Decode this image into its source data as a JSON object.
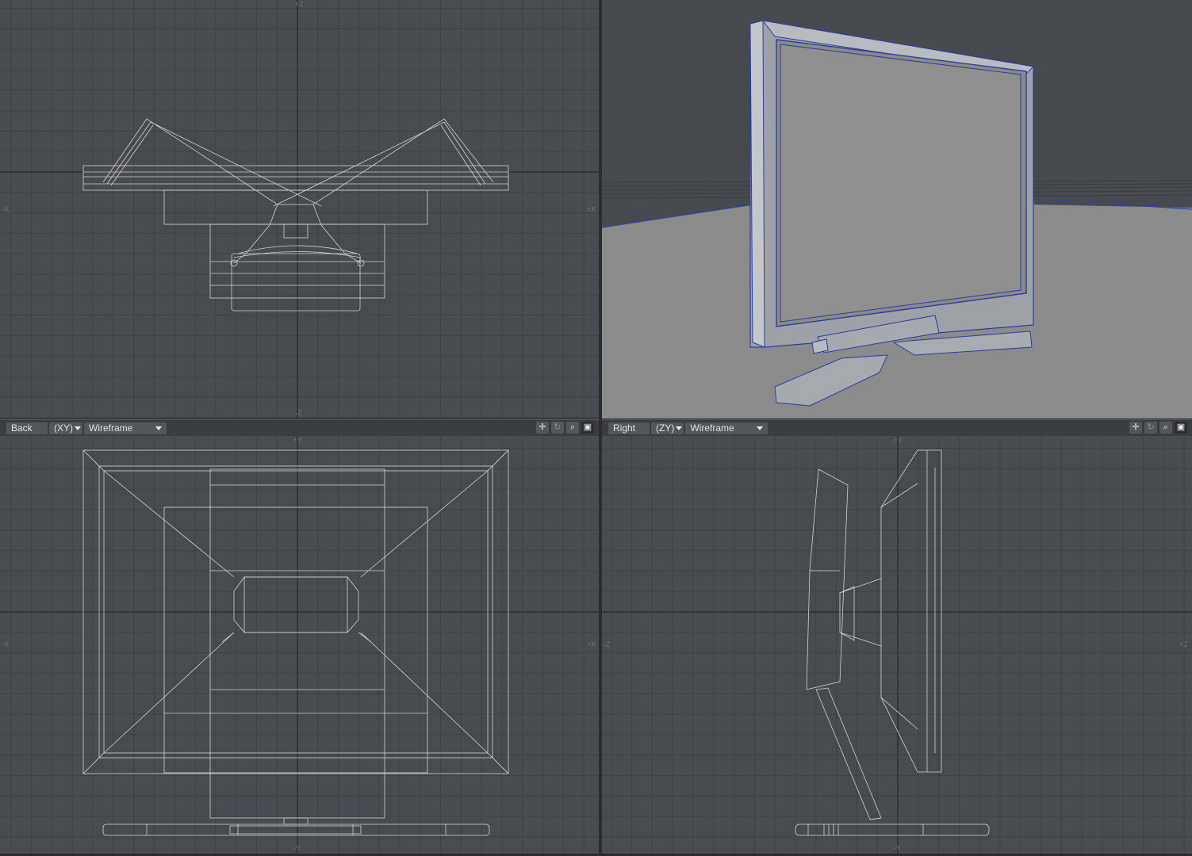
{
  "viewports": {
    "top_left": {
      "axis_x": "X",
      "axis_z": "Z"
    },
    "top_right": {
      "mode": "Perspective (shaded)"
    },
    "bottom_left": {
      "name": "Back",
      "axis": "(XY)",
      "mode": "Wireframe",
      "axis_labels": {
        "top": "+Y",
        "bottom": "-Y",
        "left": "-X",
        "right": "+X"
      }
    },
    "bottom_right": {
      "name": "Right",
      "axis": "(ZY)",
      "mode": "Wireframe",
      "axis_labels": {
        "top": "+Y",
        "bottom": "-Y",
        "left": "-Z",
        "right": "+Z"
      }
    }
  },
  "top_left_axis_labels": {
    "top": "+Z",
    "bottom": "-Z",
    "left": "-X",
    "right": "+X"
  },
  "header_icons": [
    "move-icon",
    "rotate-icon",
    "zoom-icon",
    "maximize-icon"
  ],
  "header_icon_glyphs": [
    "✛",
    "↻",
    "⌕",
    "▣"
  ],
  "colors": {
    "viewport_bg": "#484c50",
    "grid_line": "#3e4245",
    "wireframe": "#d8d8d8",
    "selection_edge": "#2c3f9e",
    "screen_fill": "#8a8a8a",
    "floor": "#8c8c8c"
  }
}
